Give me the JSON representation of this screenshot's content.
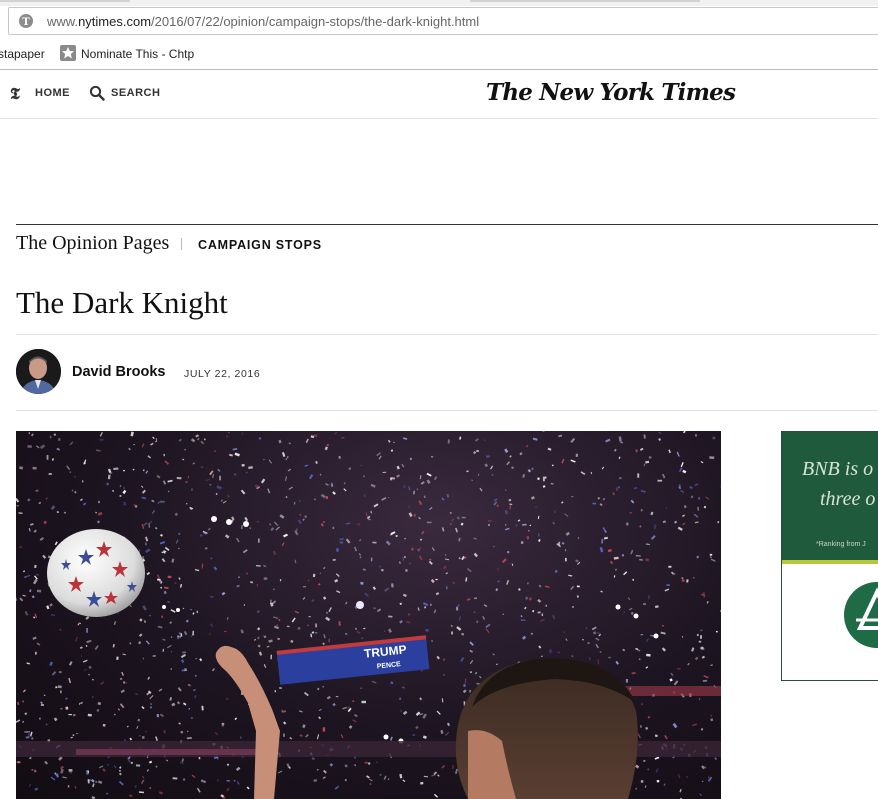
{
  "browser": {
    "url_prefix": "www.",
    "url_domain": "nytimes.com",
    "url_path": "/2016/07/22/opinion/campaign-stops/the-dark-knight.html",
    "bookmarks": [
      "stapaper",
      "Nominate This - Chtp"
    ]
  },
  "header": {
    "home_label": "HOME",
    "search_label": "SEARCH",
    "logo_text": "The New York Times"
  },
  "article": {
    "section": "The Opinion Pages",
    "subsection": "CAMPAIGN STOPS",
    "title": "The Dark Knight",
    "author": "David Brooks",
    "date": "JULY 22, 2016"
  },
  "photo": {
    "sign_line1": "TRUMP",
    "sign_line2": "PENCE"
  },
  "ad": {
    "line1": "BNB is o",
    "line2": "three o",
    "fine_print": "*Ranking from J"
  },
  "colors": {
    "ad_green": "#1f5a3c",
    "ad_accent": "#b7c93a",
    "sign_blue": "#2b3f9e"
  }
}
